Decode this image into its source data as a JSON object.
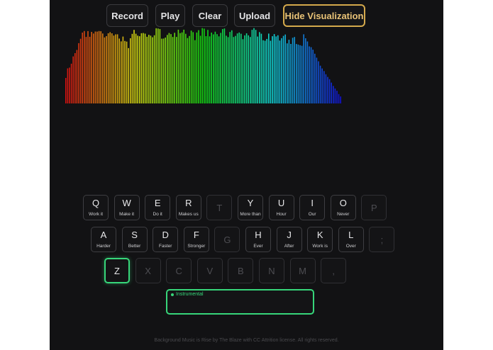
{
  "toolbar": {
    "record": "Record",
    "play": "Play",
    "clear": "Clear",
    "upload": "Upload",
    "hide_viz": "Hide Visualization",
    "accent_color": "#d4a94c"
  },
  "keyboard": {
    "row1": [
      {
        "key": "Q",
        "word": "Work it"
      },
      {
        "key": "W",
        "word": "Make it"
      },
      {
        "key": "E",
        "word": "Do it"
      },
      {
        "key": "R",
        "word": "Makes us"
      },
      {
        "key": "T",
        "word": ""
      },
      {
        "key": "Y",
        "word": "More than"
      },
      {
        "key": "U",
        "word": "Hour"
      },
      {
        "key": "I",
        "word": "Our"
      },
      {
        "key": "O",
        "word": "Never"
      },
      {
        "key": "P",
        "word": ""
      }
    ],
    "row2": [
      {
        "key": "A",
        "word": "Harder"
      },
      {
        "key": "S",
        "word": "Better"
      },
      {
        "key": "D",
        "word": "Faster"
      },
      {
        "key": "F",
        "word": "Stronger"
      },
      {
        "key": "G",
        "word": ""
      },
      {
        "key": "H",
        "word": "Ever"
      },
      {
        "key": "J",
        "word": "After"
      },
      {
        "key": "K",
        "word": "Work is"
      },
      {
        "key": "L",
        "word": "Over"
      },
      {
        "key": ";",
        "word": ""
      }
    ],
    "row3": [
      {
        "key": "Z",
        "word": "",
        "active": true
      },
      {
        "key": "X",
        "word": ""
      },
      {
        "key": "C",
        "word": ""
      },
      {
        "key": "V",
        "word": ""
      },
      {
        "key": "B",
        "word": ""
      },
      {
        "key": "N",
        "word": ""
      },
      {
        "key": "M",
        "word": ""
      },
      {
        "key": ",",
        "word": ""
      }
    ],
    "active_color": "#37d67a"
  },
  "instrument": {
    "label": "Instrumental"
  },
  "footer": {
    "text": "Background Music is Rise by The Blaze with CC Attrition license. All rights reserved."
  }
}
